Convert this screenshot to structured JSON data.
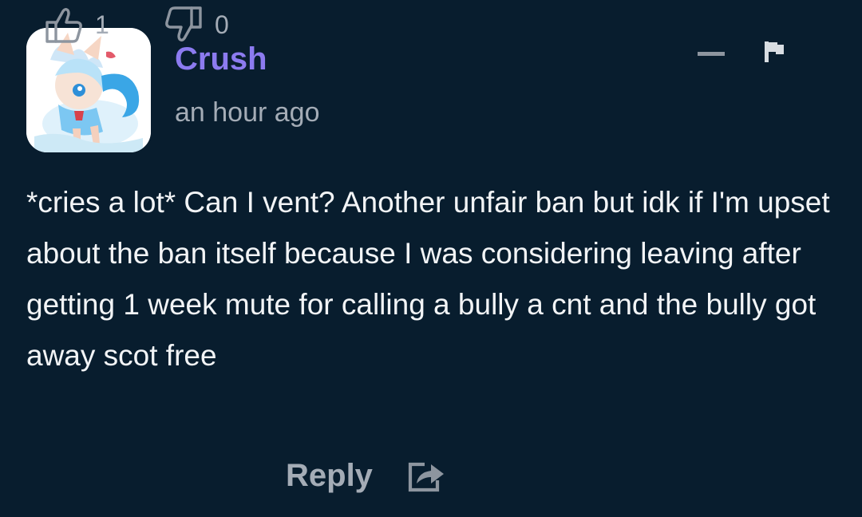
{
  "comment": {
    "username": "Crush",
    "timestamp": "an hour ago",
    "body": "*cries a lot* Can I vent? Another unfair ban but idk if I'm upset about the ban itself because I was considering leaving after getting 1 week mute for calling a bully a cnt and the bully got away scot free",
    "upvotes": "1",
    "downvotes": "0",
    "reply_label": "Reply"
  },
  "icons": {
    "collapse": "minus-icon",
    "report": "flag-icon",
    "upvote": "thumbs-up-icon",
    "downvote": "thumbs-down-icon",
    "share": "share-icon"
  },
  "colors": {
    "background": "#081d2e",
    "username": "#8c7bf0",
    "muted": "#a4acb6",
    "text": "#f2f4f6"
  }
}
